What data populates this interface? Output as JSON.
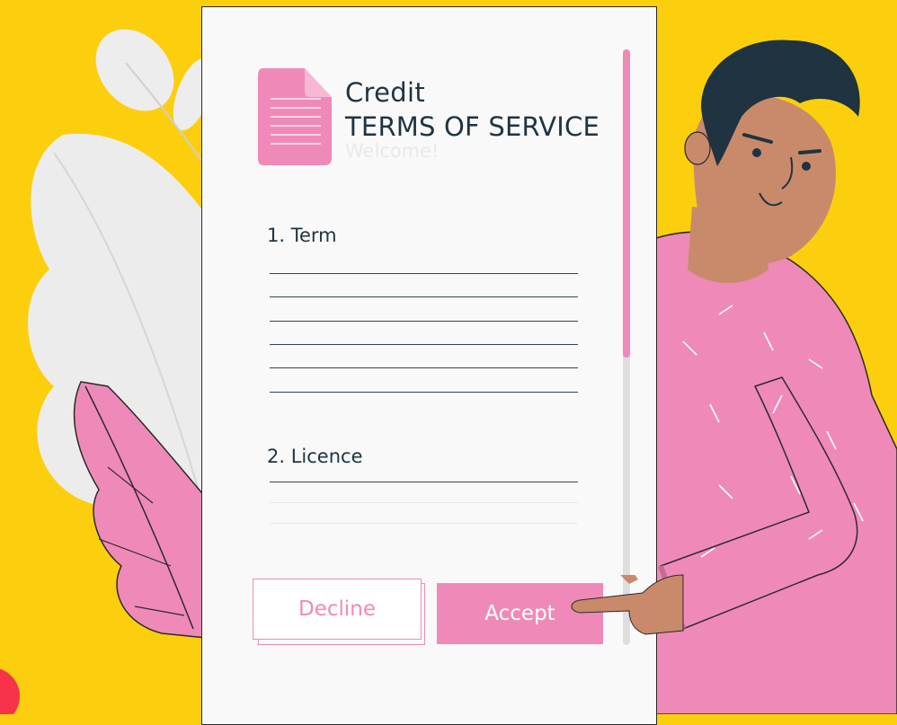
{
  "dialog": {
    "app_name": "Credit",
    "title": "TERMS OF SERVICE",
    "subtitle": "Welcome!",
    "sections": [
      {
        "heading": "1. Term"
      },
      {
        "heading": "2. Licence"
      }
    ],
    "buttons": {
      "decline_label": "Decline",
      "accept_label": "Accept"
    }
  },
  "colors": {
    "background": "#FBCF0E",
    "accent_pink": "#EF8AB8",
    "text_dark": "#1F3340",
    "card": "#F9F9F9"
  },
  "icons": [
    "document-icon",
    "scrollbar"
  ]
}
